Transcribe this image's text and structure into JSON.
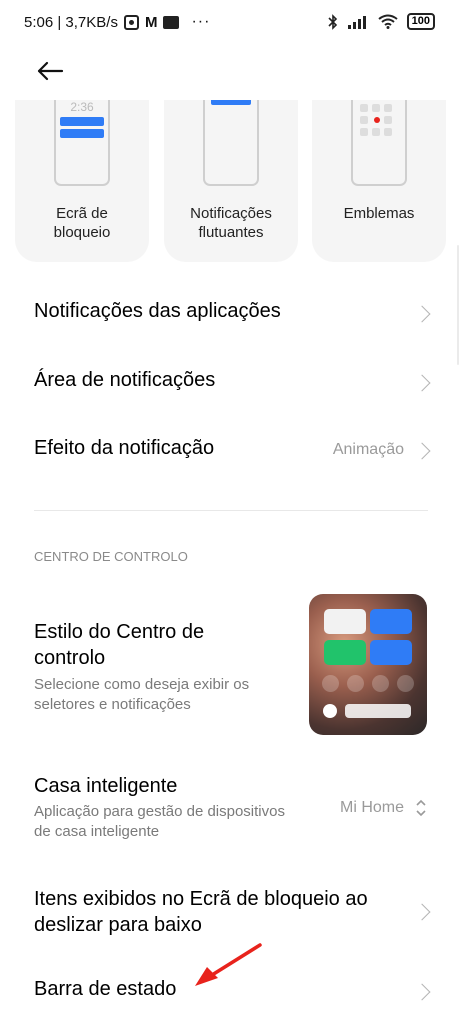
{
  "status_bar": {
    "time_speed": "5:06 | 3,7KB/s",
    "dots": "···",
    "battery": "100"
  },
  "cards": [
    {
      "label_line1": "Ecrã de",
      "label_line2": "bloqueio",
      "phone_time": "2:36"
    },
    {
      "label_line1": "Notificações",
      "label_line2": "flutuantes"
    },
    {
      "label_line1": "Emblemas",
      "label_line2": ""
    }
  ],
  "settings": {
    "app_notifications": "Notificações das aplicações",
    "notification_area": "Área de notificações",
    "notification_effect": "Efeito da notificação",
    "notification_effect_value": "Animação",
    "section_control_center": "CENTRO DE CONTROLO",
    "cc_style_line1": "Estilo do Centro de",
    "cc_style_line2": "controlo",
    "cc_style_sub_line1": "Selecione como deseja exibir os",
    "cc_style_sub_line2": "seletores e notificações",
    "smart_home": "Casa inteligente",
    "smart_home_sub_line1": "Aplicação para gestão de dispositivos",
    "smart_home_sub_line2": "de casa inteligente",
    "smart_home_value": "Mi Home",
    "lockscreen_items_line1": "Itens exibidos no Ecrã de bloqueio ao",
    "lockscreen_items_line2": "deslizar para baixo",
    "status_bar": "Barra de estado"
  },
  "colors": {
    "accent_blue": "#2f7cf6",
    "tile_green": "#21c36b",
    "arrow_red": "#e8231c"
  }
}
